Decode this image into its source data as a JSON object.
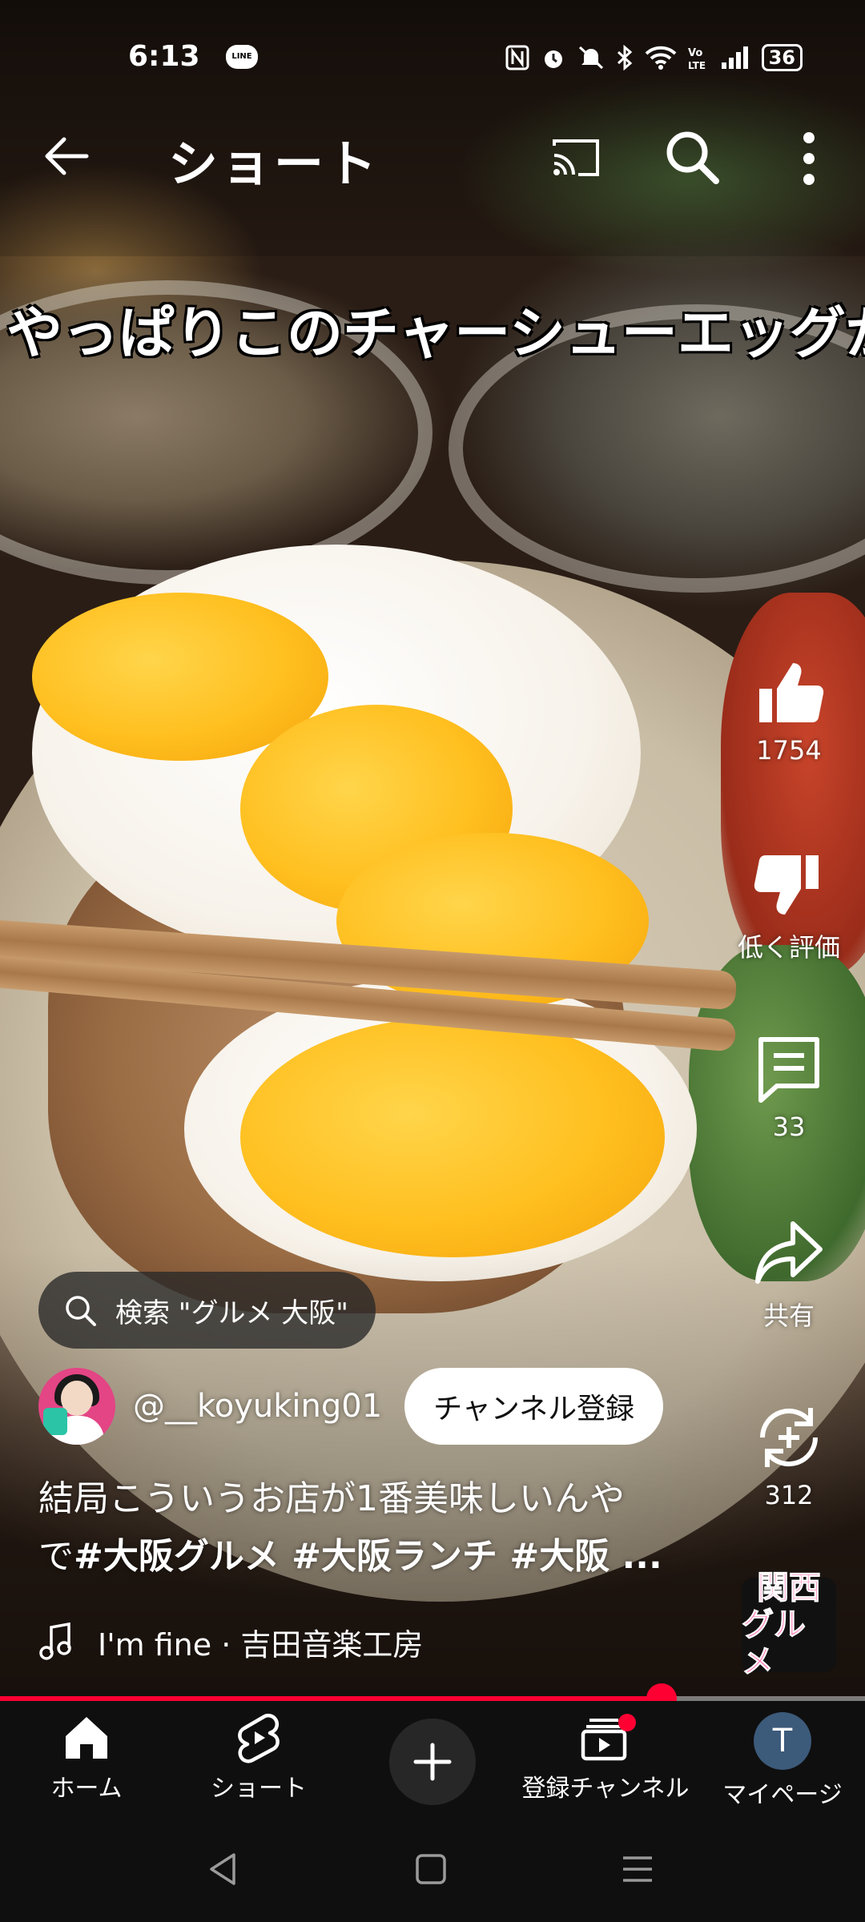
{
  "status_bar": {
    "time": "6:13",
    "line_label": "LINE",
    "battery": "36",
    "icons": [
      "nfc-icon",
      "alarm-icon",
      "mute-icon",
      "bluetooth-icon",
      "wifi-icon",
      "volte-icon",
      "signal-icon",
      "battery-icon"
    ]
  },
  "header": {
    "title": "ショート"
  },
  "video": {
    "overlay_caption": "やっぱりこのチャーシューエッグが"
  },
  "actions": {
    "like_count": "1754",
    "dislike_label": "低く評価",
    "comment_count": "33",
    "share_label": "共有",
    "remix_count": "312"
  },
  "channel_badge": {
    "line1": "関西",
    "line2": "グルメ"
  },
  "search_chip": {
    "text": "検索 \"グルメ 大阪\""
  },
  "channel": {
    "handle": "@__koyuking01",
    "subscribe_label": "チャンネル登録"
  },
  "description": {
    "line1": "結局こういうお店が1番美味しいんや",
    "line2_prefix": "で",
    "line2_tags": "#大阪グルメ #大阪ランチ #大阪 ..."
  },
  "music": {
    "text": "I'm fine · 吉田音楽工房"
  },
  "progress": {
    "fraction": 0.765,
    "accent": "#ff0033"
  },
  "bottom_nav": {
    "home": "ホーム",
    "shorts": "ショート",
    "subscriptions": "登録チャンネル",
    "you": "マイページ",
    "you_initial": "T"
  }
}
